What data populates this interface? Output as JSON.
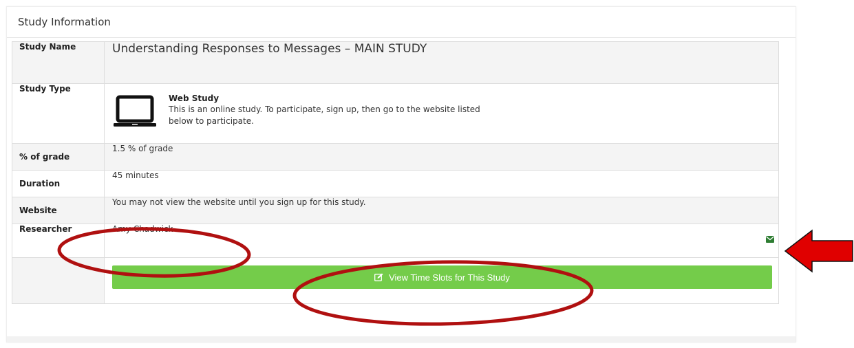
{
  "panel": {
    "heading": "Study Information"
  },
  "rows": {
    "study_name": {
      "label": "Study Name",
      "value": "Understanding Responses to Messages – MAIN STUDY"
    },
    "study_type": {
      "label": "Study Type",
      "icon": "laptop-icon",
      "type_title": "Web Study",
      "type_description": "This is an online study. To participate, sign up, then go to the website listed below to participate."
    },
    "grade": {
      "label": "% of grade",
      "value": "1.5 % of grade"
    },
    "duration": {
      "label": "Duration",
      "value": "45 minutes"
    },
    "website": {
      "label": "Website",
      "value": "You may not view the website until you sign up for this study."
    },
    "researcher": {
      "label": "Researcher",
      "value": "Amy Chadwick",
      "contact_icon": "envelope-icon"
    }
  },
  "actions": {
    "view_slots_label": "View Time Slots for This Study",
    "view_slots_icon": "edit-icon"
  },
  "annotations": {
    "circle_color": "#b01010",
    "arrow_color": "#e00000",
    "button_color": "#74cc4a",
    "envelope_color": "#2e7d32"
  }
}
